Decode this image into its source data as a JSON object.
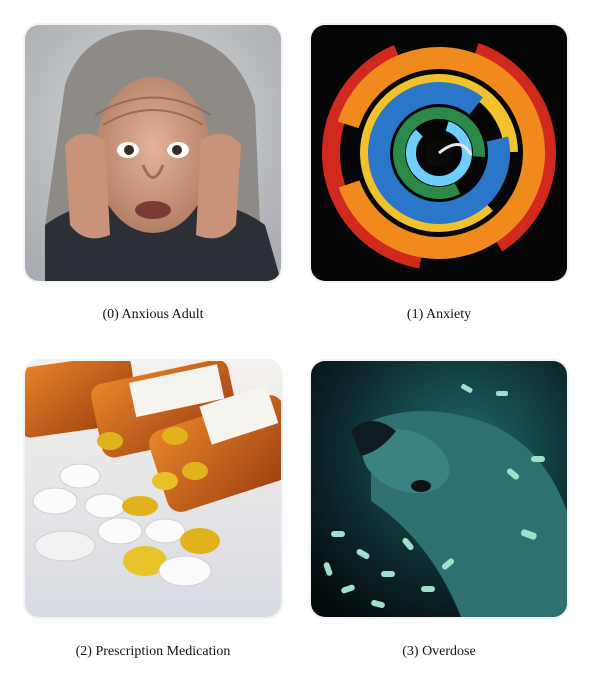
{
  "panels": [
    {
      "index": 0,
      "caption": "(0) Anxious Adult",
      "image": "anxious-adult-photo"
    },
    {
      "index": 1,
      "caption": "(1) Anxiety",
      "image": "color-swirl-painting"
    },
    {
      "index": 2,
      "caption": "(2) Prescription Medication",
      "image": "spilled-pills-photo"
    },
    {
      "index": 3,
      "caption": "(3) Overdose",
      "image": "collapsed-man-pills-photo"
    }
  ],
  "colors": {
    "background": "#ffffff",
    "swirl_orange": "#f08a1c",
    "swirl_blue": "#2a76c8",
    "pill_yellow": "#e2b21d",
    "bottle_amber": "#c4621a",
    "overdose_teal": "#1f6b6a"
  }
}
